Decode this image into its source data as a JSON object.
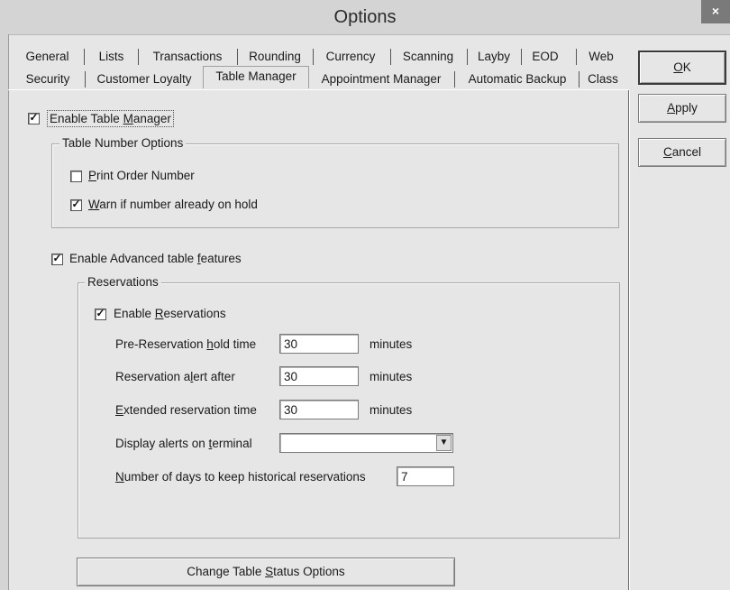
{
  "window": {
    "title": "Options",
    "close_glyph": "×"
  },
  "tabs_row1": [
    "General",
    "Lists",
    "Transactions",
    "Rounding",
    "Currency",
    "Scanning",
    "Layby",
    "EOD",
    "Web"
  ],
  "tabs_row2": [
    "Security",
    "Customer Loyalty",
    "Table Manager",
    "Appointment Manager",
    "Automatic Backup",
    "Class"
  ],
  "active_tab": "Table Manager",
  "buttons": {
    "ok": {
      "mnemonic": "O",
      "rest": "K"
    },
    "apply": {
      "mnemonic": "A",
      "rest": "pply"
    },
    "cancel": {
      "mnemonic": "C",
      "rest": "ancel"
    },
    "change_status": {
      "pre": "Change Table ",
      "mnemonic": "S",
      "rest": "tatus Options"
    }
  },
  "enable_table_manager": {
    "pre": "Enable Table ",
    "mnemonic": "M",
    "rest": "anager",
    "checked": true
  },
  "table_number_options": {
    "title": "Table Number Options",
    "print_order": {
      "mnemonic": "P",
      "rest": "rint Order Number",
      "checked": false
    },
    "warn_on_hold": {
      "mnemonic": "W",
      "rest": "arn if number already on hold",
      "checked": true
    }
  },
  "enable_advanced": {
    "pre": "Enable Advanced table ",
    "mnemonic": "f",
    "rest": "eatures",
    "checked": true
  },
  "reservations": {
    "title": "Reservations",
    "enable": {
      "pre": "Enable ",
      "mnemonic": "R",
      "rest": "eservations",
      "checked": true
    },
    "pre_hold": {
      "pre": "Pre-Reservation ",
      "mnemonic": "h",
      "rest": "old time",
      "value": "30",
      "unit": "minutes"
    },
    "alert_after": {
      "pre": "Reservation a",
      "mnemonic": "l",
      "rest": "ert after",
      "value": "30",
      "unit": "minutes"
    },
    "extended": {
      "pre": "",
      "mnemonic": "E",
      "rest": "xtended reservation time",
      "value": "30",
      "unit": "minutes"
    },
    "display_alerts": {
      "pre": "Display alerts on ",
      "mnemonic": "t",
      "rest": "erminal",
      "value": ""
    },
    "history_days": {
      "pre": "",
      "mnemonic": "N",
      "rest": "umber of days to keep historical reservations",
      "value": "7"
    }
  },
  "colors": {
    "window_bg": "#e6e6e6",
    "titlebar": "#d4d4d4",
    "close_button": "#7a7a7a"
  }
}
